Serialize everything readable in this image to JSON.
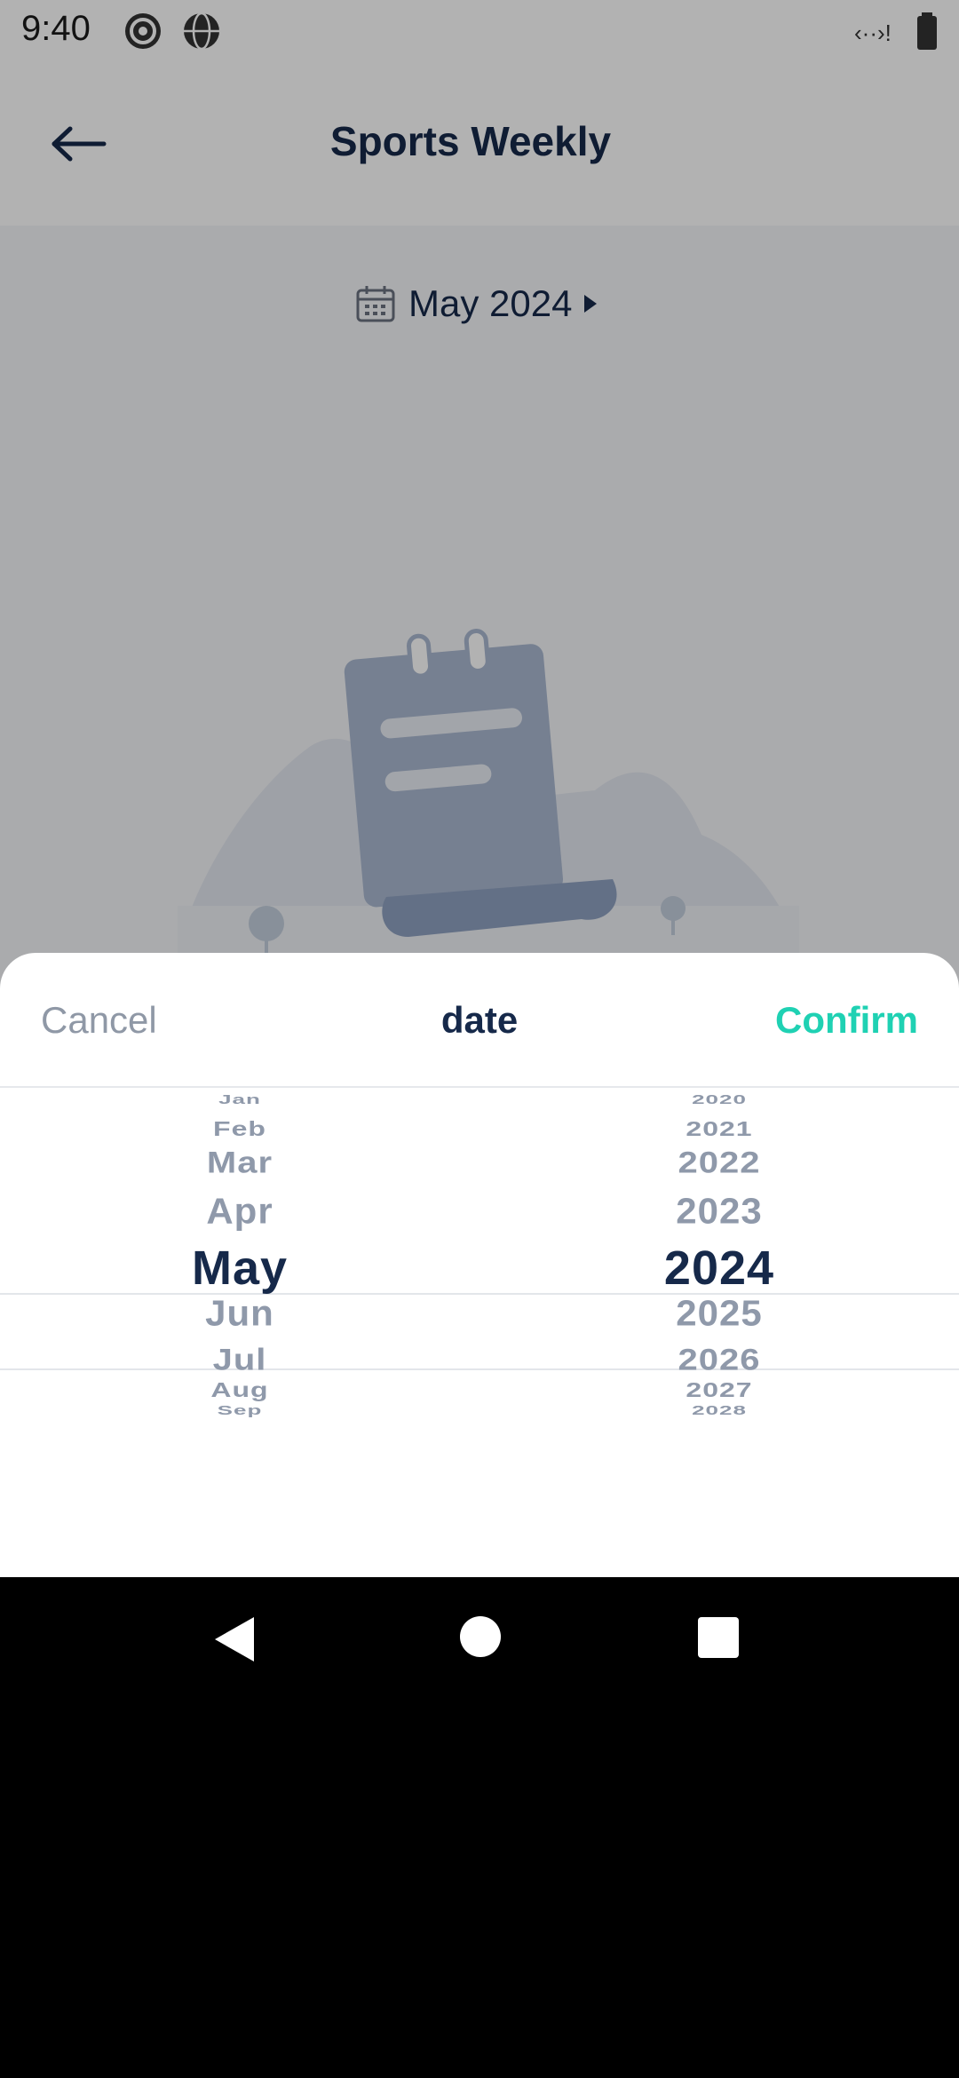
{
  "status_bar": {
    "time": "9:40"
  },
  "app_bar": {
    "title": "Sports Weekly"
  },
  "month_selector": {
    "label": "May 2024"
  },
  "date_sheet": {
    "cancel_label": "Cancel",
    "title": "date",
    "confirm_label": "Confirm",
    "confirm_color": "#1fd1b3"
  },
  "picker": {
    "months": [
      "Jan",
      "Feb",
      "Mar",
      "Apr",
      "May",
      "Jun",
      "Jul",
      "Aug",
      "Sep"
    ],
    "years": [
      "2020",
      "2021",
      "2022",
      "2023",
      "2024",
      "2025",
      "2026",
      "2027",
      "2028"
    ],
    "selected_month": "May",
    "selected_year": "2024"
  }
}
